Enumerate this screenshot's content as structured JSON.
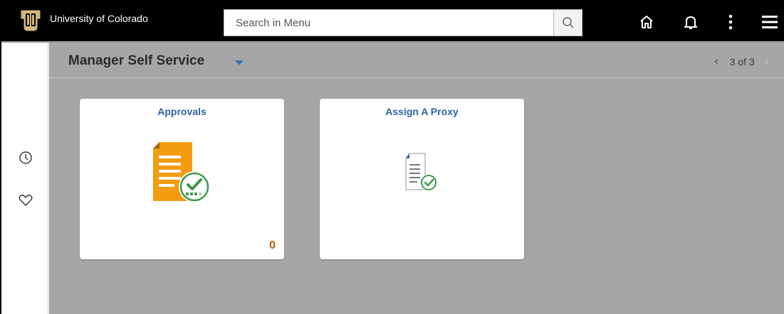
{
  "header": {
    "brand": "University of Colorado",
    "search": {
      "placeholder": "Search in Menu",
      "value": ""
    },
    "icons": [
      "cu-logo-icon",
      "search-icon",
      "home-icon",
      "bell-icon",
      "more-vertical-icon",
      "hamburger-menu-icon"
    ]
  },
  "rail": {
    "icons": [
      "recent-clock-icon",
      "favorites-heart-icon"
    ]
  },
  "page": {
    "title": "Manager Self Service",
    "pager": {
      "text": "3 of 3",
      "prev": "‹",
      "next": "›"
    }
  },
  "tiles": [
    {
      "title": "Approvals",
      "count": "0",
      "icon": "approvals-document-check-icon"
    },
    {
      "title": "Assign A Proxy",
      "icon": "proxy-document-check-icon"
    }
  ],
  "colors": {
    "banner": "#000000",
    "accent_blue": "#2d63a8",
    "count_orange": "#b65c0f",
    "logo_gold": "#cfb87c",
    "canvas_gray": "#a5a6a5"
  }
}
